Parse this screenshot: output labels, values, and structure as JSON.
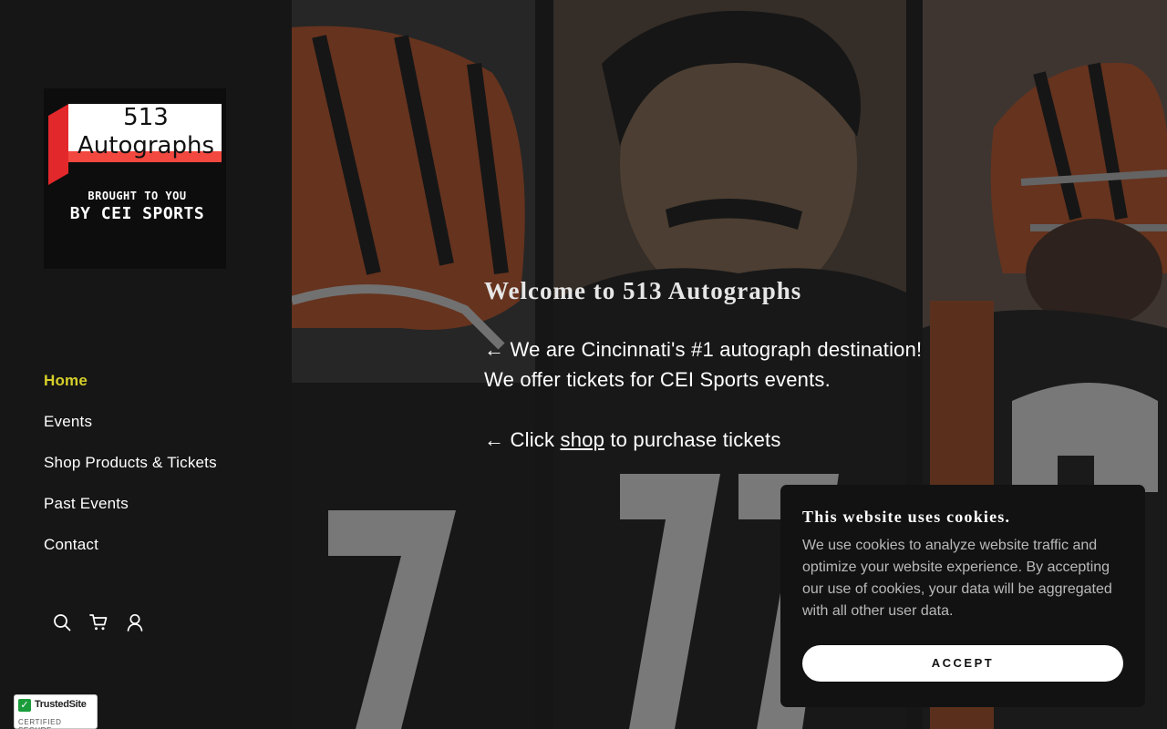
{
  "logo": {
    "line1": "513",
    "line2": "Autographs",
    "sub1": "BROUGHT TO YOU",
    "sub2": "BY CEI SPORTS"
  },
  "nav": {
    "items": [
      {
        "label": "Home",
        "active": true
      },
      {
        "label": "Events"
      },
      {
        "label": "Shop Products & Tickets"
      },
      {
        "label": "Past Events"
      },
      {
        "label": "Contact"
      }
    ]
  },
  "icons": [
    "search-icon",
    "cart-icon",
    "account-icon"
  ],
  "badge": {
    "title": "TrustedSite",
    "subtitle": "CERTIFIED SECURE"
  },
  "hero": {
    "heading": "Welcome to 513 Autographs",
    "line1": "← We are Cincinnati's #1 autograph destination!",
    "line2": "We offer tickets for CEI Sports events.",
    "line3_prefix": "← Click ",
    "line3_link": "shop",
    "line3_suffix": " to purchase tickets"
  },
  "cookie": {
    "title": "This website uses cookies.",
    "body": "We use cookies to analyze website traffic and optimize your website experience. By accepting our use of cookies, your data will be aggregated with all other user data.",
    "accept_label": "ACCEPT"
  },
  "colors": {
    "sidebar_bg": "#161616",
    "nav_active": "#d6cf2a",
    "cookie_bg": "#121212"
  }
}
